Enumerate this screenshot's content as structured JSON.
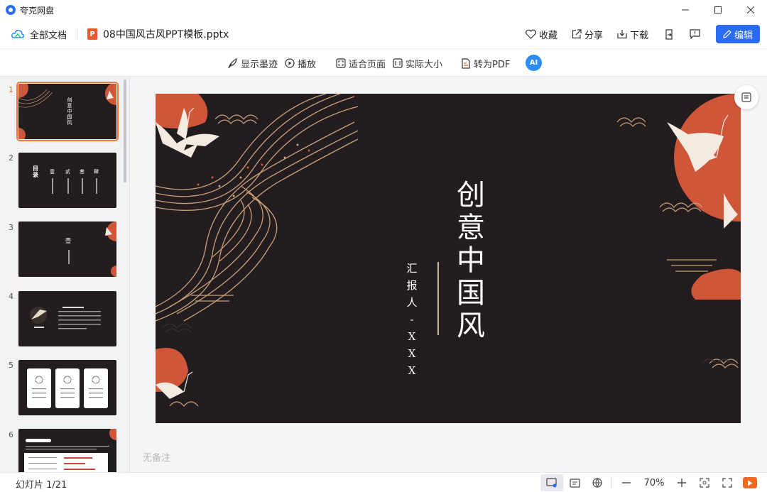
{
  "app": {
    "title": "夸克网盘"
  },
  "header": {
    "root_label": "全部文档",
    "file_name": "08中国风古风PPT模板.pptx",
    "file_badge": "P",
    "actions": {
      "favorite": "收藏",
      "share": "分享",
      "download": "下载"
    },
    "edit_label": "编辑"
  },
  "toolbar": {
    "ink": "显示墨迹",
    "play": "播放",
    "fit_page": "适合页面",
    "actual_size": "实际大小",
    "to_pdf": "转为PDF",
    "ai": "AI"
  },
  "sidebar": {
    "thumbs": [
      {
        "num": "1",
        "selected": true
      },
      {
        "num": "2"
      },
      {
        "num": "3"
      },
      {
        "num": "4"
      },
      {
        "num": "5"
      },
      {
        "num": "6"
      }
    ],
    "thumb_texts": {
      "t1_title": "创意中国风",
      "t2_title": "目录",
      "t2_items": [
        "壹",
        "贰",
        "叁",
        "肆"
      ],
      "t3_title": "壹"
    }
  },
  "slide": {
    "title_chars": [
      "创",
      "意",
      "中",
      "国",
      "风"
    ],
    "subtitle_chars": [
      "汇",
      "报",
      "人",
      "-",
      "X",
      "X",
      "X"
    ],
    "colors": {
      "bg": "#231d20",
      "accent": "#d0563a",
      "gold": "#c9a07a",
      "crane": "#f3ebe2"
    }
  },
  "notes": {
    "placeholder": "无备注"
  },
  "status": {
    "slide_counter": "幻灯片 1/21",
    "zoom": "70%"
  }
}
